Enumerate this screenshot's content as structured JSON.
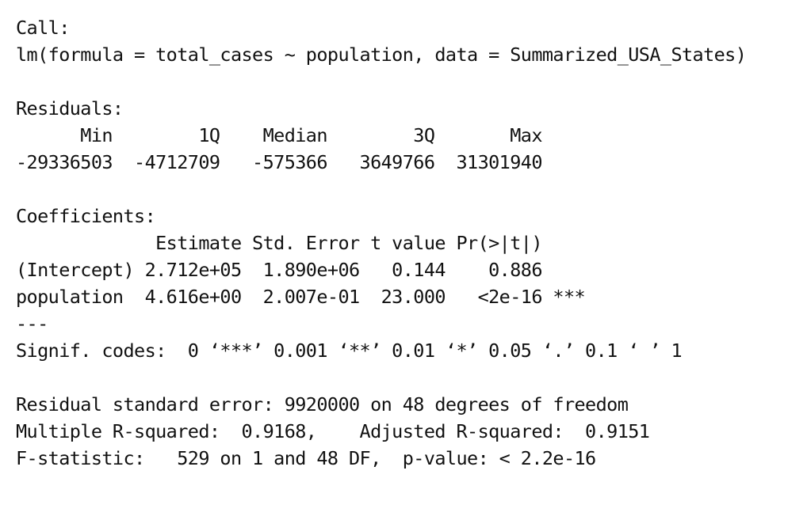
{
  "call": {
    "header": "Call:",
    "formula": "lm(formula = total_cases ~ population, data = Summarized_USA_States)"
  },
  "residuals": {
    "header": "Residuals:",
    "labels_line": "      Min        1Q    Median        3Q       Max ",
    "values_line": "-29336503  -4712709   -575366   3649766  31301940 "
  },
  "coefficients": {
    "header": "Coefficients:",
    "column_header_line": "             Estimate Std. Error t value Pr(>|t|)    ",
    "rows": [
      "(Intercept) 2.712e+05  1.890e+06   0.144    0.886    ",
      "population  4.616e+00  2.007e-01  23.000   <2e-16 ***"
    ],
    "separator": "---",
    "signif_codes": "Signif. codes:  0 ‘***’ 0.001 ‘**’ 0.01 ‘*’ 0.05 ‘.’ 0.1 ‘ ’ 1"
  },
  "summary": {
    "residual_std_error": "Residual standard error: 9920000 on 48 degrees of freedom",
    "r_squared": "Multiple R-squared:  0.9168,\tAdjusted R-squared:  0.9151 ",
    "f_statistic": "F-statistic:   529 on 1 and 48 DF,  p-value: < 2.2e-16"
  }
}
